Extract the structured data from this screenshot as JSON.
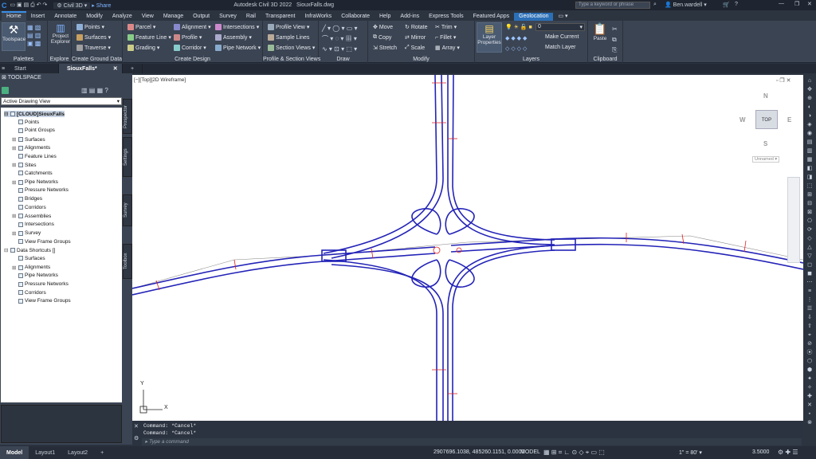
{
  "titlebar": {
    "workspace": "Civil 3D",
    "share": "Share",
    "title": "Autodesk Civil 3D 2022",
    "file": "SiouxFalls.dwg",
    "search_placeholder": "Type a keyword or phrase",
    "user": "Ben.wardell"
  },
  "tabs": [
    "Home",
    "Insert",
    "Annotate",
    "Modify",
    "Analyze",
    "View",
    "Manage",
    "Output",
    "Survey",
    "Rail",
    "Transparent",
    "InfraWorks",
    "Collaborate",
    "Help",
    "Add-ins",
    "Express Tools",
    "Featured Apps",
    "Geolocation"
  ],
  "ribbon": {
    "toolspace": "Toolspace",
    "project_explorer_1": "Project",
    "project_explorer_2": "Explorer",
    "points": "Points",
    "surfaces": "Surfaces",
    "traverse": "Traverse",
    "parcel": "Parcel",
    "feature_line": "Feature Line",
    "grading": "Grading",
    "alignment": "Alignment",
    "profile": "Profile",
    "corridor": "Corridor",
    "intersections": "Intersections",
    "assembly": "Assembly",
    "pipe_network": "Pipe Network",
    "profile_view": "Profile View",
    "sample_lines": "Sample Lines",
    "section_views": "Section Views",
    "move": "Move",
    "copy": "Copy",
    "stretch": "Stretch",
    "rotate": "Rotate",
    "mirror": "Mirror",
    "scale": "Scale",
    "trim": "Trim",
    "fillet": "Fillet",
    "array": "Array",
    "layer_props_1": "Layer",
    "layer_props_2": "Properties",
    "layer_value": "0",
    "make_current": "Make Current",
    "match_layer": "Match Layer",
    "paste": "Paste",
    "groups": {
      "palettes": "Palettes",
      "explore": "Explore",
      "create_ground": "Create Ground Data",
      "create_design": "Create Design",
      "profile_section": "Profile & Section Views",
      "draw": "Draw",
      "modify": "Modify",
      "layers": "Layers",
      "clipboard": "Clipboard"
    }
  },
  "doc_tabs": [
    "Start",
    "SiouxFalls*"
  ],
  "toolspace": {
    "header": "TOOLSPACE",
    "view_select": "Active Drawing View",
    "vertical_tabs": [
      "Prospector",
      "Settings",
      "Survey",
      "Toolbox"
    ],
    "tree": [
      {
        "label": "[CLOUD]SiouxFalls",
        "level": 0,
        "expander": "-"
      },
      {
        "label": "Points",
        "level": 1,
        "expander": ""
      },
      {
        "label": "Point Groups",
        "level": 1,
        "expander": ""
      },
      {
        "label": "Surfaces",
        "level": 1,
        "expander": "+"
      },
      {
        "label": "Alignments",
        "level": 1,
        "expander": "+"
      },
      {
        "label": "Feature Lines",
        "level": 1,
        "expander": ""
      },
      {
        "label": "Sites",
        "level": 1,
        "expander": "+"
      },
      {
        "label": "Catchments",
        "level": 1,
        "expander": ""
      },
      {
        "label": "Pipe Networks",
        "level": 1,
        "expander": "+"
      },
      {
        "label": "Pressure Networks",
        "level": 1,
        "expander": ""
      },
      {
        "label": "Bridges",
        "level": 1,
        "expander": ""
      },
      {
        "label": "Corridors",
        "level": 1,
        "expander": ""
      },
      {
        "label": "Assemblies",
        "level": 1,
        "expander": "+"
      },
      {
        "label": "Intersections",
        "level": 1,
        "expander": ""
      },
      {
        "label": "Survey",
        "level": 1,
        "expander": "+"
      },
      {
        "label": "View Frame Groups",
        "level": 1,
        "expander": ""
      },
      {
        "label": "Data Shortcuts []",
        "level": 0,
        "expander": "-"
      },
      {
        "label": "Surfaces",
        "level": 1,
        "expander": ""
      },
      {
        "label": "Alignments",
        "level": 1,
        "expander": "+"
      },
      {
        "label": "Pipe Networks",
        "level": 1,
        "expander": ""
      },
      {
        "label": "Pressure Networks",
        "level": 1,
        "expander": ""
      },
      {
        "label": "Corridors",
        "level": 1,
        "expander": ""
      },
      {
        "label": "View Frame Groups",
        "level": 1,
        "expander": ""
      }
    ]
  },
  "viewport": {
    "label": "[−][Top][2D Wireframe]",
    "viewcube_top": "TOP",
    "compass_n": "N",
    "compass_s": "S",
    "compass_e": "E",
    "compass_w": "W",
    "ucs_name": "Unnamed",
    "axis_x": "X",
    "axis_y": "Y"
  },
  "command": {
    "history": [
      "Command: *Cancel*",
      "Command: *Cancel*"
    ],
    "placeholder": "Type a command"
  },
  "status": {
    "layouts": [
      "Model",
      "Layout1",
      "Layout2"
    ],
    "coords": "2907696.1038, 485260.1151, 0.0000",
    "mode": "MODEL",
    "scale": "1\" = 80'",
    "value": "3.5000"
  },
  "colors": {
    "accent": "#3a8ee6",
    "road": "#2323b8",
    "stationing": "#e02020"
  }
}
